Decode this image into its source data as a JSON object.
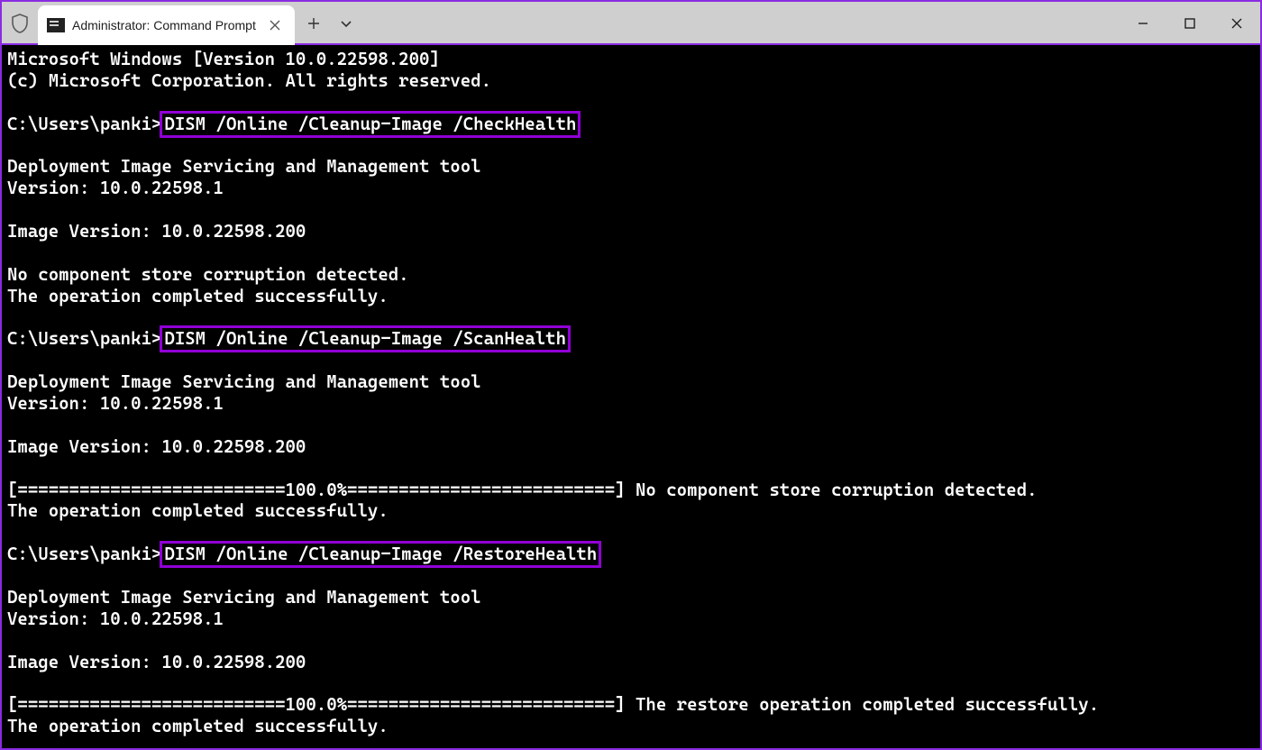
{
  "tab": {
    "title": "Administrator: Command Prompt"
  },
  "highlight_color": "#9100d6",
  "term": {
    "banner1": "Microsoft Windows [Version 10.0.22598.200]",
    "banner2": "(c) Microsoft Corporation. All rights reserved.",
    "prompt": "C:\\Users\\panki>",
    "cmd1": "DISM /Online /Cleanup-Image /CheckHealth",
    "cmd2": "DISM /Online /Cleanup-Image /ScanHealth",
    "cmd3": "DISM /Online /Cleanup-Image /RestoreHealth",
    "dism_header": "Deployment Image Servicing and Management tool",
    "dism_ver": "Version: 10.0.22598.1",
    "img_ver": "Image Version: 10.0.22598.200",
    "nocorrupt": "No component store corruption detected.",
    "opdone": "The operation completed successfully.",
    "progbar": "[==========================100.0%==========================] ",
    "scan_tail": "No component store corruption detected.",
    "restore_tail": "The restore operation completed successfully."
  }
}
